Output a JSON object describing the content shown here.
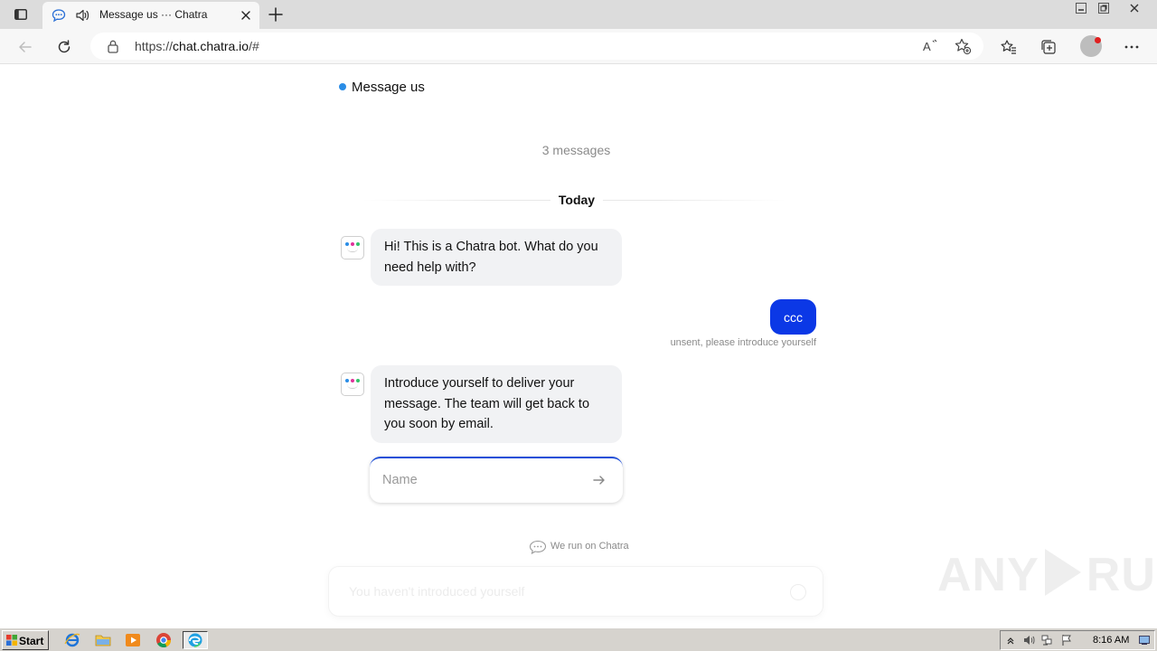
{
  "browser": {
    "tab": {
      "title": "Message us ··· Chatra"
    },
    "address": {
      "scheme": "https://",
      "host": "chat.chatra.io",
      "path": "/#"
    }
  },
  "chat": {
    "header_title": "Message us",
    "message_count": "3 messages",
    "day_divider": "Today",
    "messages": [
      {
        "sender": "bot",
        "text": "Hi! This is a Chatra bot. What do you need help with?"
      },
      {
        "sender": "user",
        "text": "ccc",
        "status": "unsent, please introduce yourself"
      },
      {
        "sender": "bot",
        "text": "Introduce yourself to deliver your message. The team will get back to you soon by email."
      }
    ],
    "name_input": {
      "placeholder": "Name",
      "value": ""
    },
    "powered_by": "We run on Chatra",
    "composer_placeholder": "You haven't introduced yourself"
  },
  "watermark": {
    "left": "ANY",
    "right": "RUN"
  },
  "taskbar": {
    "start_label": "Start",
    "clock": "8:16 AM"
  },
  "colors": {
    "accent": "#0b38e6",
    "status_online": "#2a8de6",
    "bubble_in": "#f1f2f4",
    "input_focus": "#1f4fd8"
  },
  "icons": [
    "tab-actions-icon",
    "chat-favicon-icon",
    "speaker-icon",
    "close-icon",
    "plus-icon",
    "minimize-icon",
    "restore-icon",
    "back-arrow-icon",
    "refresh-icon",
    "lock-icon",
    "read-aloud-icon",
    "add-favorite-icon",
    "favorites-icon",
    "collections-icon",
    "profile-avatar-icon",
    "more-icon",
    "bot-avatar-icon",
    "send-arrow-icon",
    "chat-bubble-icon",
    "emoji-icon"
  ]
}
